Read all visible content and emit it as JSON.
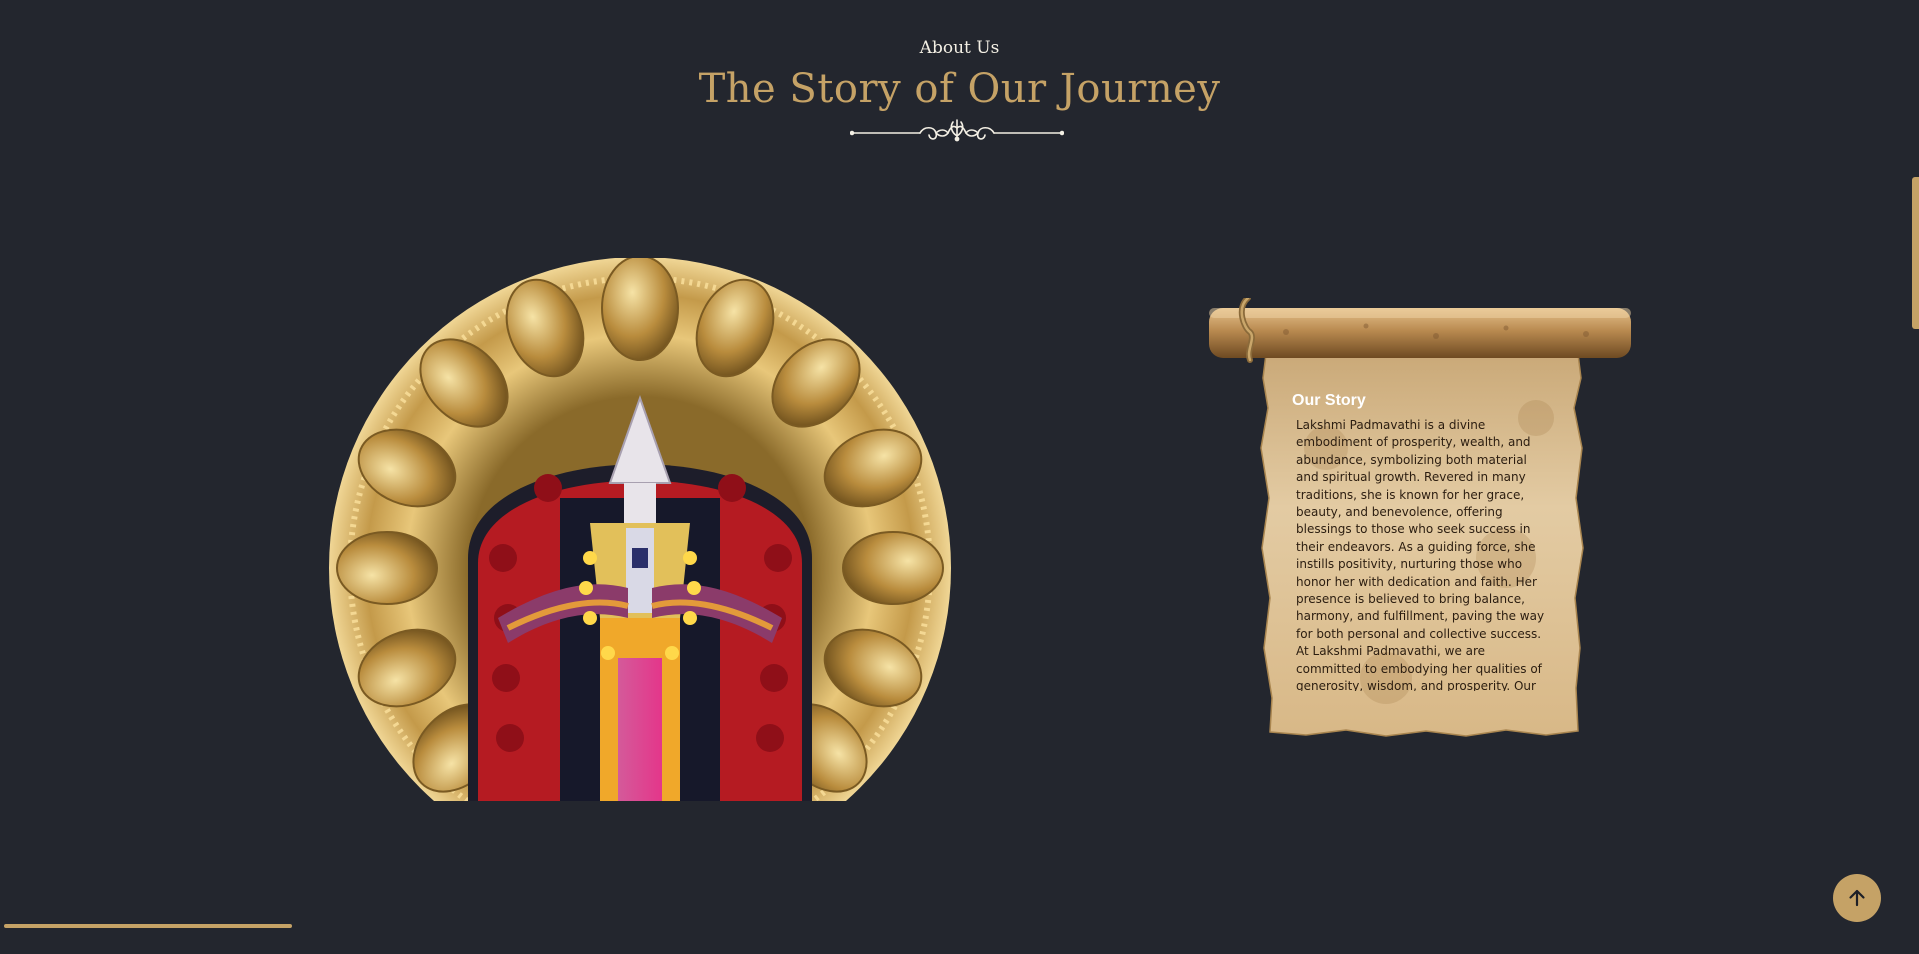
{
  "header": {
    "eyebrow": "About Us",
    "title": "The Story of Our Journey"
  },
  "story": {
    "heading": "Our Story",
    "body": "Lakshmi Padmavathi is a divine embodiment of prosperity, wealth, and abundance, symbolizing both material and spiritual growth. Revered in many traditions, she is known for her grace, beauty, and benevolence, offering blessings to those who seek success in their endeavors. As a guiding force, she instills positivity, nurturing those who honor her with dedication and faith. Her presence is believed to bring balance, harmony, and fulfillment, paving the way for both personal and collective success. At Lakshmi Padmavathi, we are committed to embodying her qualities of generosity, wisdom, and prosperity. Our"
  },
  "page_progress": 0.15,
  "icons": {
    "divider": "ornamental-divider-icon",
    "back_to_top": "arrow-up-icon"
  },
  "colors": {
    "background": "#23262e",
    "accent_gold": "#c5a266",
    "text_light": "#f3efe4"
  }
}
